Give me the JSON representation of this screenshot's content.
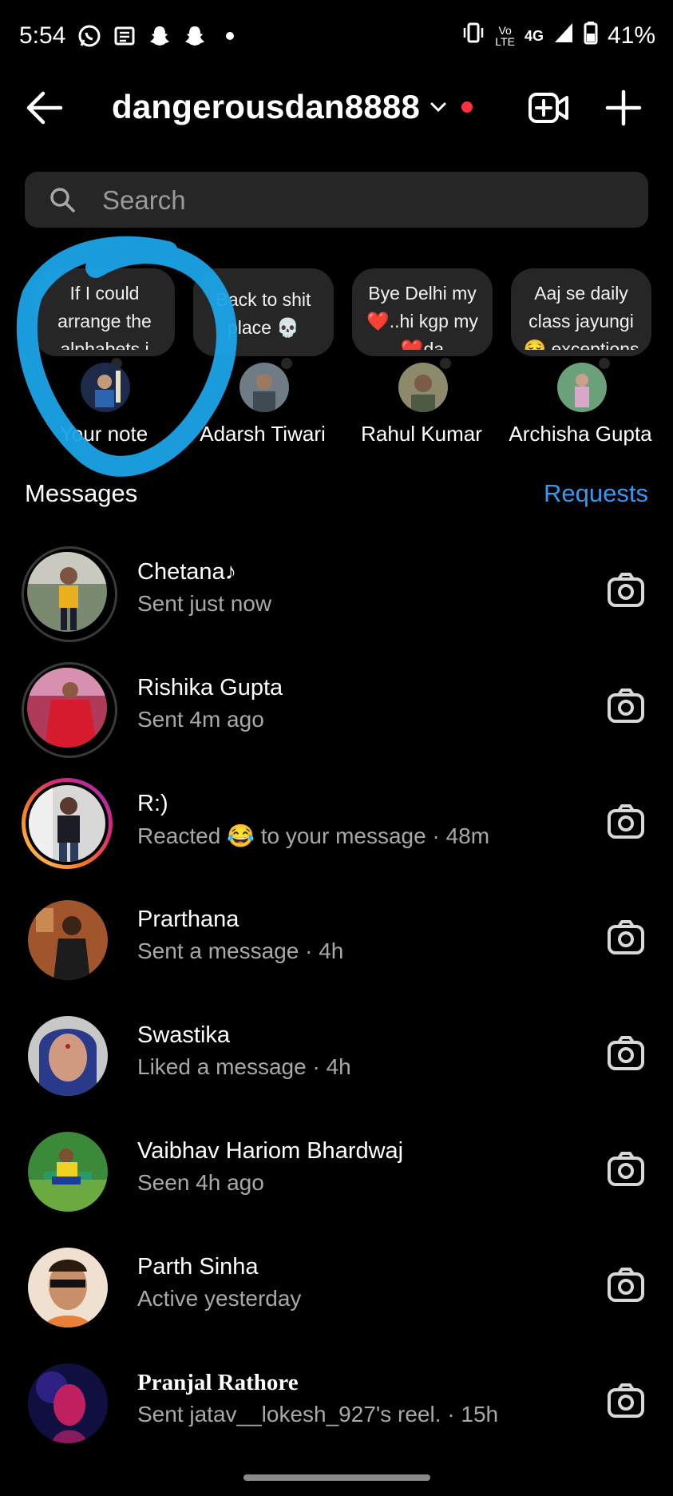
{
  "status_bar": {
    "time": "5:54",
    "network": "4G",
    "battery": "41%",
    "icons_left": [
      "whatsapp-icon",
      "news-icon",
      "snapchat-icon",
      "snapchat-icon",
      "dot-icon"
    ],
    "icons_right": [
      "vibrate-icon",
      "volte-icon",
      "signal-icon",
      "battery-icon"
    ]
  },
  "header": {
    "username": "dangerousdan8888",
    "accent": "#ff3040"
  },
  "search": {
    "placeholder": "Search"
  },
  "notes": [
    {
      "text": "If I could arrange the alphabets i",
      "name": "Your note"
    },
    {
      "text": "Back to shit place 💀",
      "name": "Adarsh Tiwari"
    },
    {
      "text": "Bye Delhi my ❤️..hi kgp my ❤️da",
      "name": "Rahul Kumar"
    },
    {
      "text": "Aaj se daily class jayungi 😌 exceptions",
      "name": "Archisha Gupta"
    }
  ],
  "messages_section": {
    "title": "Messages",
    "requests": "Requests",
    "requests_color": "#3897f0"
  },
  "conversations": [
    {
      "name": "Chetana♪",
      "status": "Sent just now",
      "ring": "seen"
    },
    {
      "name": "Rishika Gupta",
      "status": "Sent 4m ago",
      "ring": "seen"
    },
    {
      "name": "R:)",
      "status": "Reacted 😂 to your message · 48m",
      "ring": "story"
    },
    {
      "name": "Prarthana",
      "status": "Sent a message · 4h",
      "ring": "none"
    },
    {
      "name": "Swastika",
      "status": "Liked a message · 4h",
      "ring": "none"
    },
    {
      "name": "Vaibhav Hariom Bhardwaj",
      "status": "Seen 4h ago",
      "ring": "none"
    },
    {
      "name": "Parth Sinha",
      "status": "Active yesterday",
      "ring": "none"
    },
    {
      "name": "Pranjal Rathore",
      "status": "Sent jatav__lokesh_927's reel. · 15h",
      "ring": "none"
    }
  ]
}
